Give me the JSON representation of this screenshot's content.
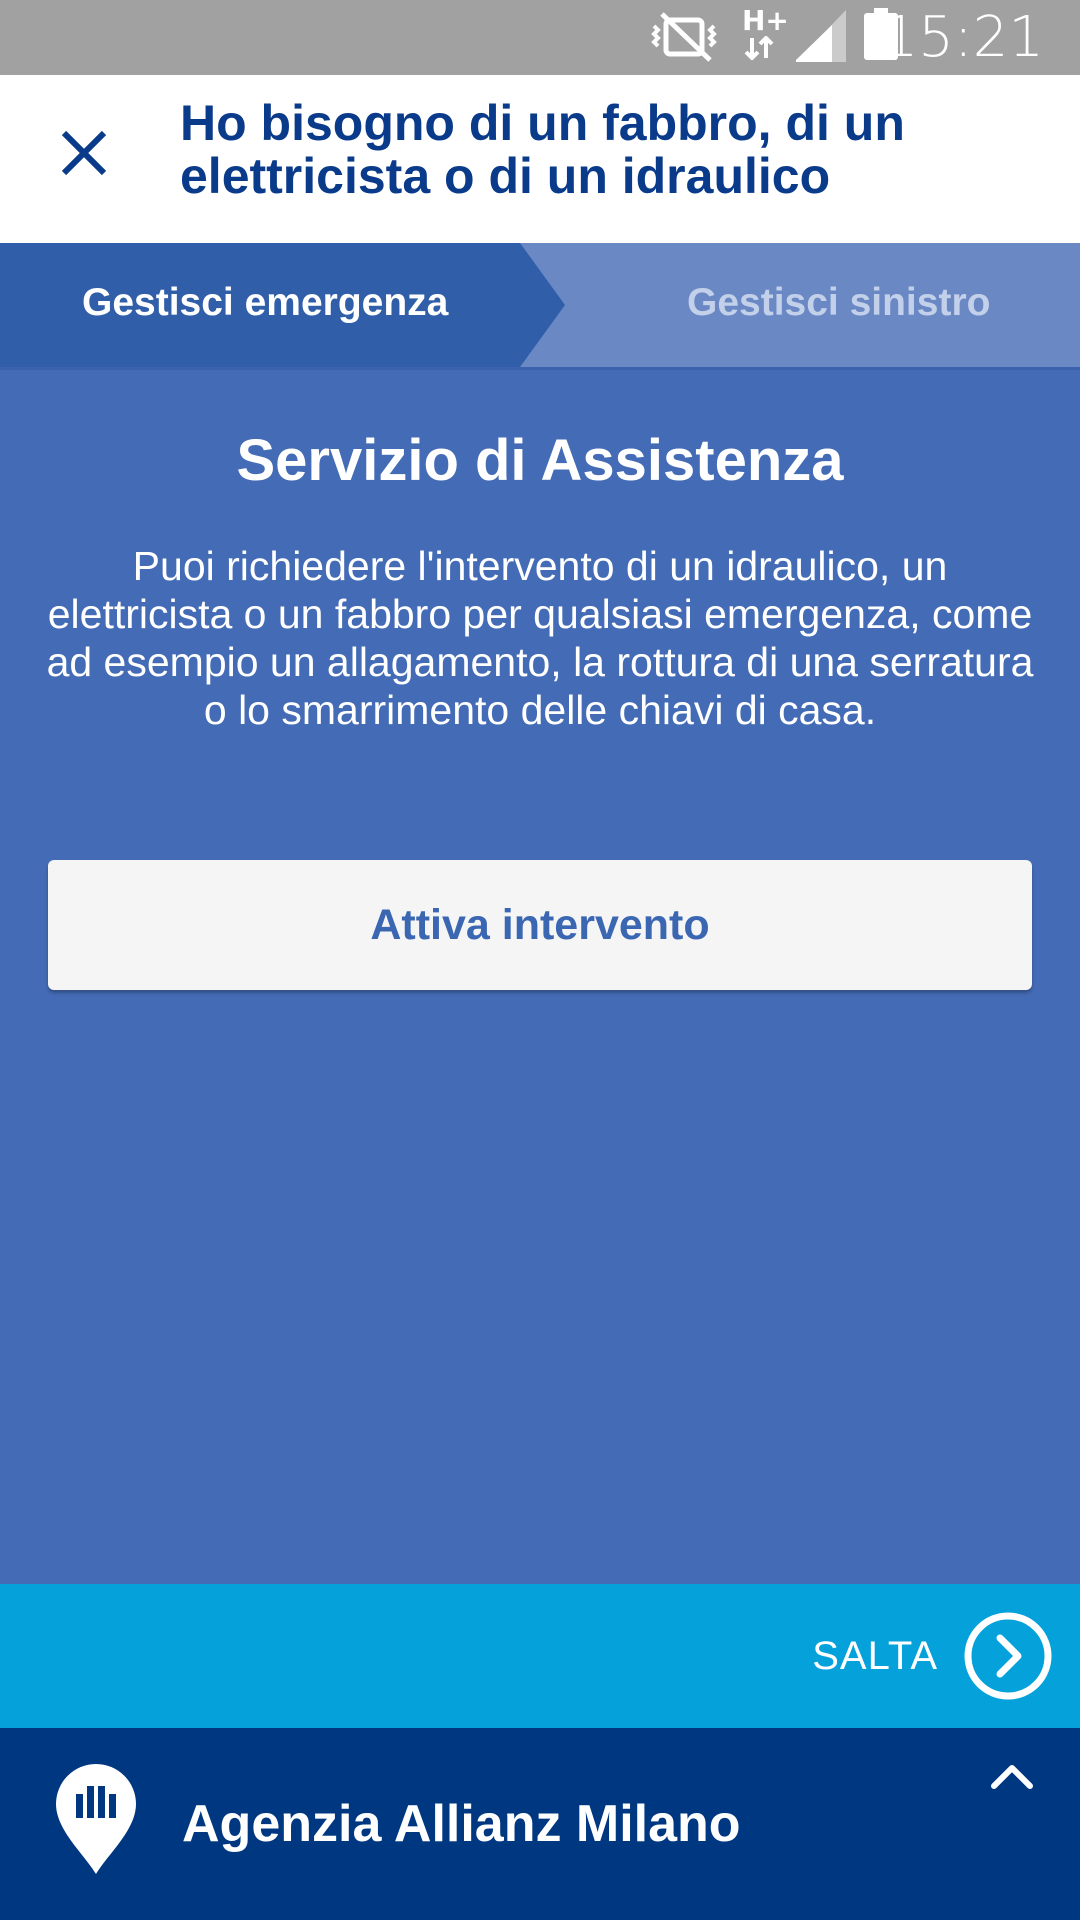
{
  "status_bar": {
    "time": "15:21",
    "network_label": "H+",
    "icons": [
      "mute-vibrate-icon",
      "network-hplus-icon",
      "signal-icon",
      "battery-icon"
    ]
  },
  "header": {
    "title": "Ho bisogno di un fabbro, di un elettricista o di un idraulico",
    "close_icon": "close-icon"
  },
  "steps": [
    {
      "label": "Gestisci emergenza",
      "active": true
    },
    {
      "label": "Gestisci sinistro",
      "active": false
    }
  ],
  "main": {
    "title": "Servizio di Assistenza",
    "description": "Puoi richiedere l'intervento di un idraulico, un elettricista o un fabbro per qualsiasi emergenza, come ad esempio un allagamento, la rottura di una serratura o lo smarrimento delle chiavi di casa.",
    "button_label": "Attiva intervento"
  },
  "skip": {
    "label": "SALTA",
    "icon": "chevron-right-circle-icon"
  },
  "agency": {
    "name": "Agenzia Allianz Milano",
    "icon": "location-pin-icon",
    "expand_icon": "chevron-up-icon"
  },
  "colors": {
    "status_bar": "#a1a1a1",
    "header_bg": "#ffffff",
    "title_text": "#0a3a8a",
    "step_active": "#305ea9",
    "step_inactive": "#6a88c4",
    "content_bg": "#446bb5",
    "button_bg": "#f5f5f5",
    "button_text": "#3a66b2",
    "skip_bar": "#04a1db",
    "agency_bar": "#003781"
  }
}
